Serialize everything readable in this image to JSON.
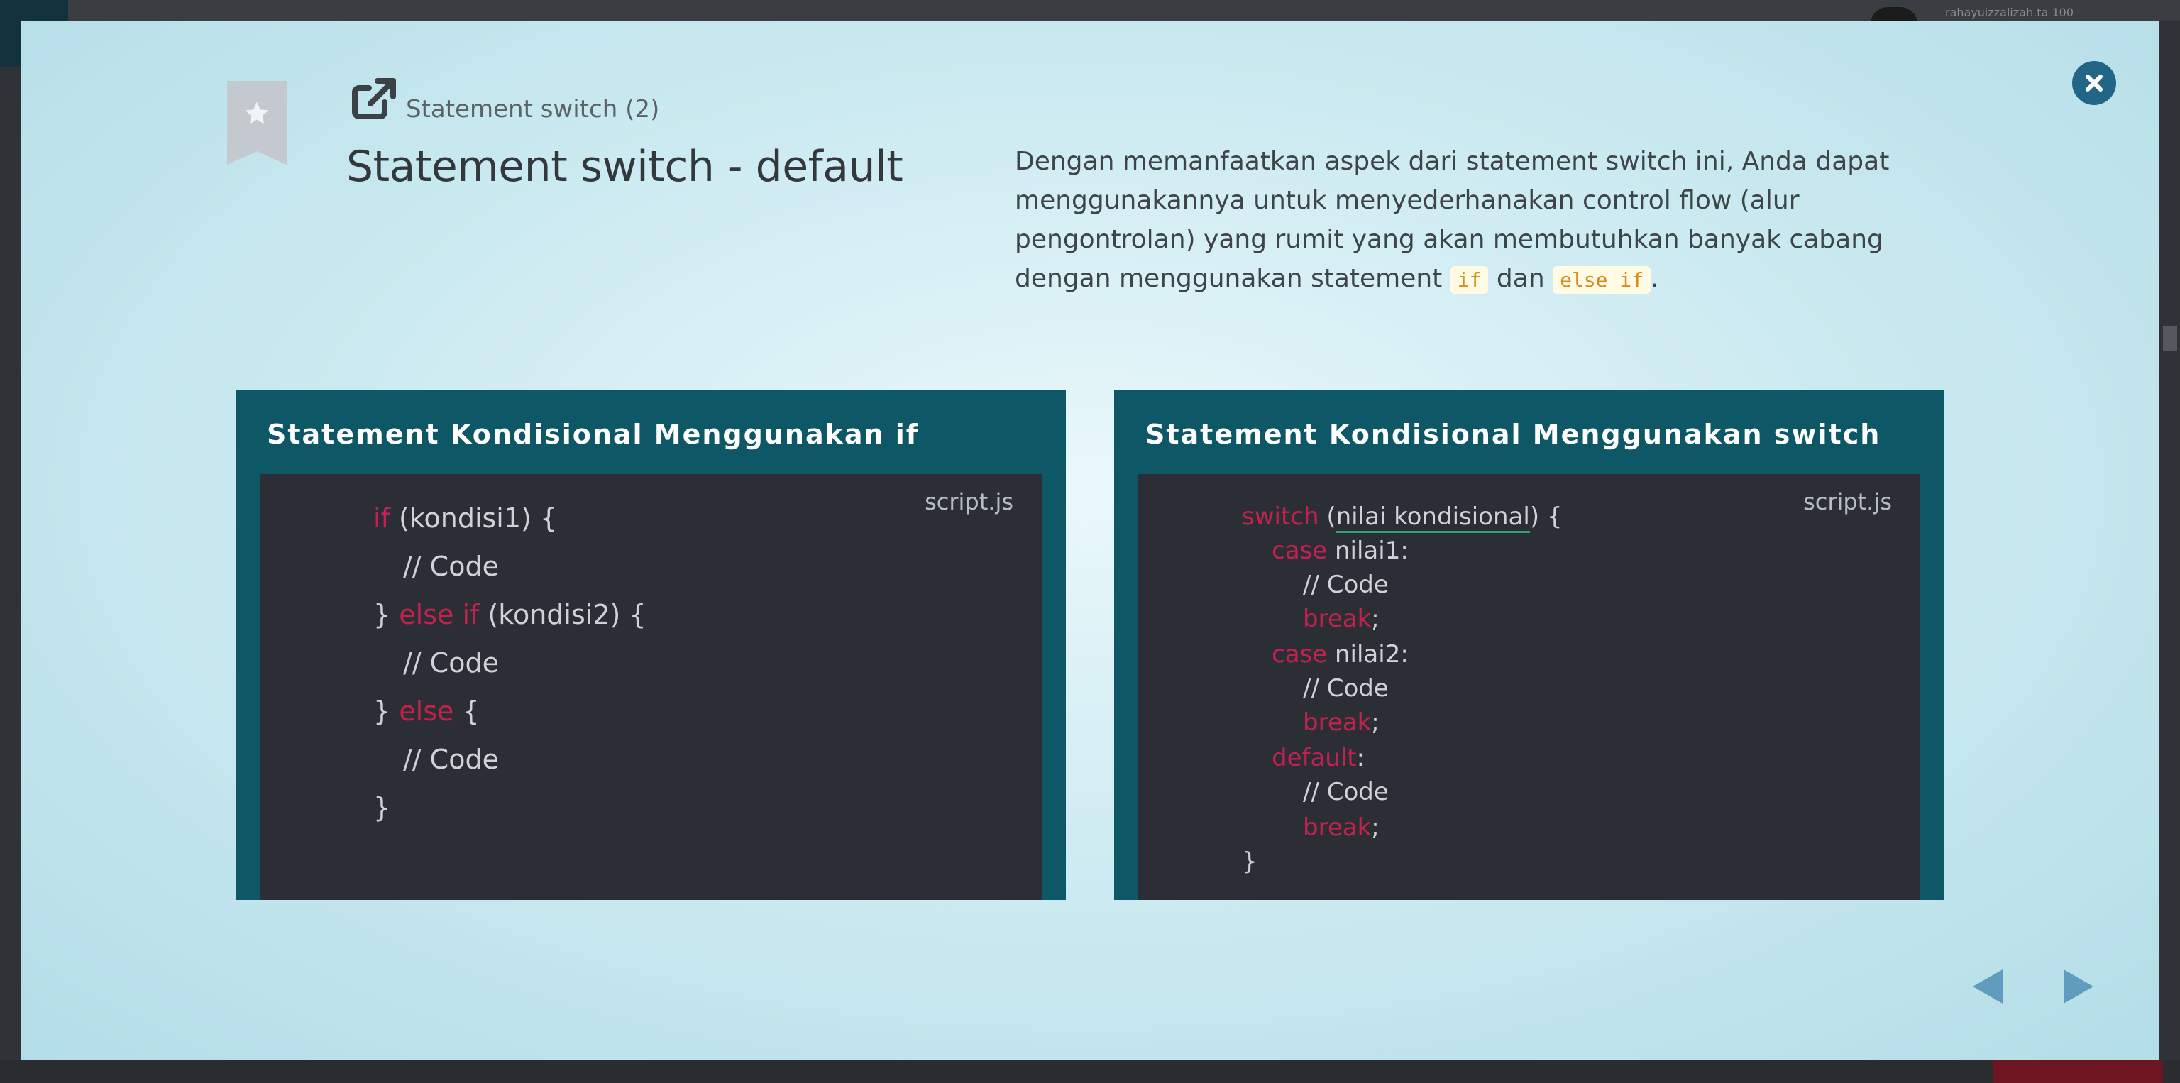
{
  "background": {
    "username": "rahayuizzalizah.ta 100"
  },
  "modal": {
    "subtitle": "Statement switch (2)",
    "title": "Statement switch - default",
    "description_parts": {
      "before": "Dengan memanfaatkan aspek dari statement switch ini, Anda dapat menggunakannya untuk menyederhanakan control flow (alur pengontrolan) yang rumit yang akan membutuhkan banyak cabang dengan menggunakan statement ",
      "code1": "if",
      "middle": " dan ",
      "code2": "else if",
      "after": "."
    },
    "icons": {
      "bookmark": "bookmark-star-icon",
      "external": "external-link-icon",
      "close": "close-icon",
      "prev": "arrow-left-icon",
      "next": "arrow-right-icon"
    },
    "colors": {
      "card_bg": "#0e5766",
      "code_bg": "#2b2f35",
      "keyword": "#c5214e",
      "close_btn": "#236587"
    }
  },
  "cards": {
    "left": {
      "title": "Statement Kondisional Menggunakan if",
      "filename": "script.js",
      "line1_kw": "if",
      "line1_rest": " (kondisi1) {",
      "line2": "// Code",
      "line3_pre": "} ",
      "line3_kw": "else if",
      "line3_rest": " (kondisi2) {",
      "line4": "// Code",
      "line5_pre": "} ",
      "line5_kw": "else",
      "line5_rest": " {",
      "line6": "// Code",
      "line7": "}"
    },
    "right": {
      "title": "Statement Kondisional Menggunakan switch",
      "filename": "script.js",
      "line1_kw": "switch",
      "line1_open": " (",
      "line1_arg": "nilai kondisional",
      "line1_close": ") {",
      "case_kw": "case",
      "case1_val": " nilai1:",
      "code_comment": "// Code",
      "break_kw": "break",
      "semicolon": ";",
      "case2_val": " nilai2:",
      "default_kw": "default",
      "colon": ":",
      "close_brace": "}"
    }
  }
}
